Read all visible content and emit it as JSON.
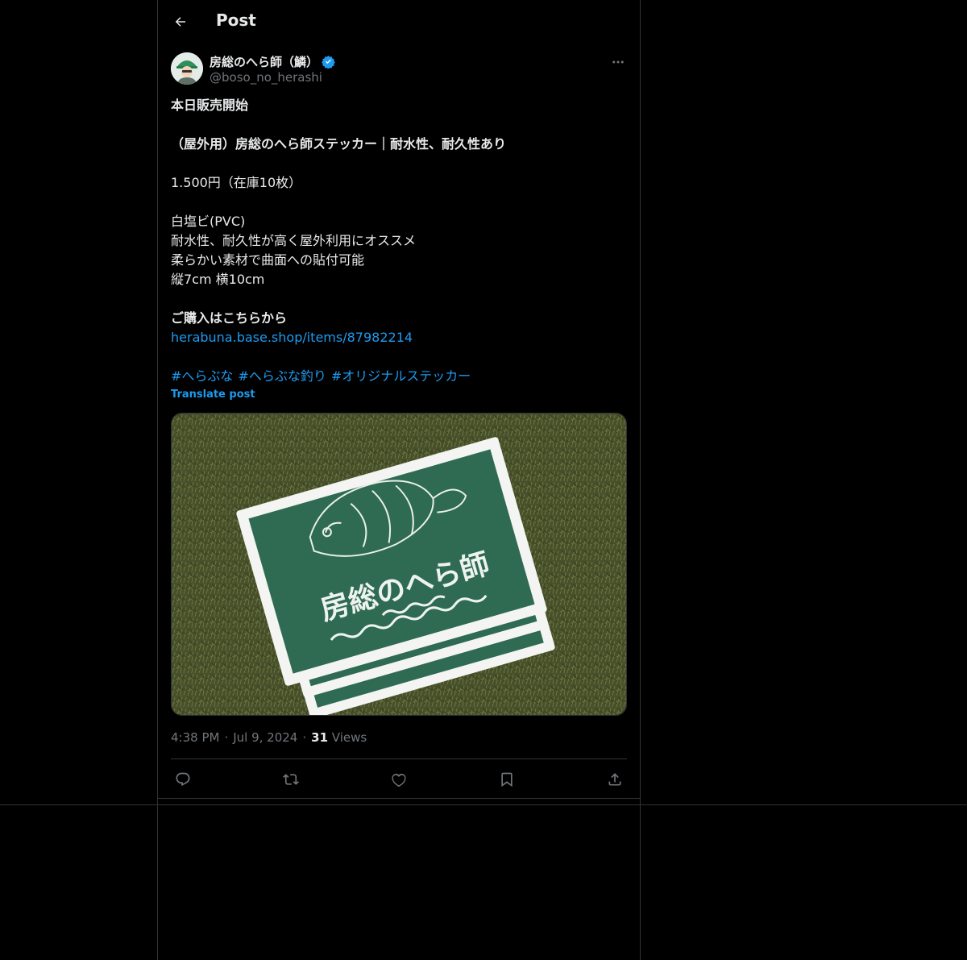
{
  "header": {
    "title": "Post"
  },
  "author": {
    "name": "房総のへら師（鱗）",
    "handle": "@boso_no_herashi"
  },
  "post": {
    "lines": [
      {
        "text": "本日販売開始",
        "style": "bold"
      },
      {
        "text": "",
        "style": "blank"
      },
      {
        "text": "（屋外用）房総のへら師ステッカー｜耐水性、耐久性あり",
        "style": "bold"
      },
      {
        "text": "",
        "style": "blank"
      },
      {
        "text": "1.500円（在庫10枚）",
        "style": "normal"
      },
      {
        "text": "",
        "style": "blank"
      },
      {
        "text": "白塩ビ(PVC)",
        "style": "normal"
      },
      {
        "text": "耐水性、耐久性が高く屋外利用にオススメ",
        "style": "normal"
      },
      {
        "text": "柔らかい素材で曲面への貼付可能",
        "style": "normal"
      },
      {
        "text": "縦7cm 横10cm",
        "style": "normal"
      },
      {
        "text": "",
        "style": "blank"
      },
      {
        "text": "ご購入はこちらから",
        "style": "bold"
      }
    ],
    "link": "herabuna.base.shop/items/87982214",
    "hashtags": [
      "#へらぶな",
      "#へらぶな釣り",
      "#オリジナルステッカー"
    ],
    "translate_label": "Translate post"
  },
  "media": {
    "sticker_text": "房総のへら師"
  },
  "meta": {
    "time": "4:38 PM",
    "date": "Jul 9, 2024",
    "views_count": "31",
    "views_label": "Views"
  },
  "colors": {
    "accent": "#1d9bf0",
    "sticker_green": "#2e6b52"
  }
}
